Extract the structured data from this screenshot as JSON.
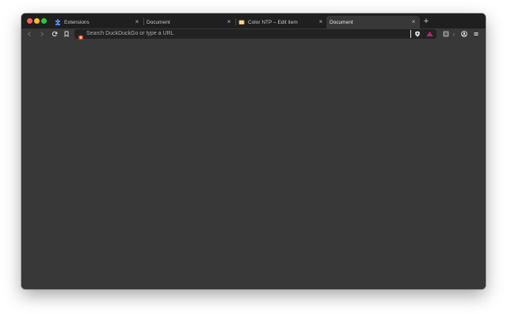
{
  "tabs": [
    {
      "title": "Extensions",
      "icon": "puzzle-icon",
      "active": false
    },
    {
      "title": "Document",
      "icon": "none",
      "active": false
    },
    {
      "title": "Color NTP – Edit item",
      "icon": "color-ntp-icon",
      "active": false
    },
    {
      "title": "Document",
      "icon": "none",
      "active": true
    }
  ],
  "new_tab_label": "+",
  "close_glyph": "×",
  "address_bar": {
    "placeholder": "Search DuckDuckGo or type a URL"
  },
  "toolbar": {
    "back_icon": "back-arrow-icon",
    "forward_icon": "forward-arrow-icon",
    "reload_icon": "reload-icon",
    "bookmark_icon": "bookmark-icon",
    "shield_icon": "brave-shields-icon",
    "rewards_icon": "brave-rewards-icon",
    "extension_icon": "extension-icon",
    "profile_icon": "profile-icon",
    "menu_icon": "menu-icon"
  },
  "colors": {
    "tab_strip": "#1f1f1f",
    "toolbar": "#383838",
    "url_field": "#222222",
    "brave_orange": "#fb542b"
  }
}
